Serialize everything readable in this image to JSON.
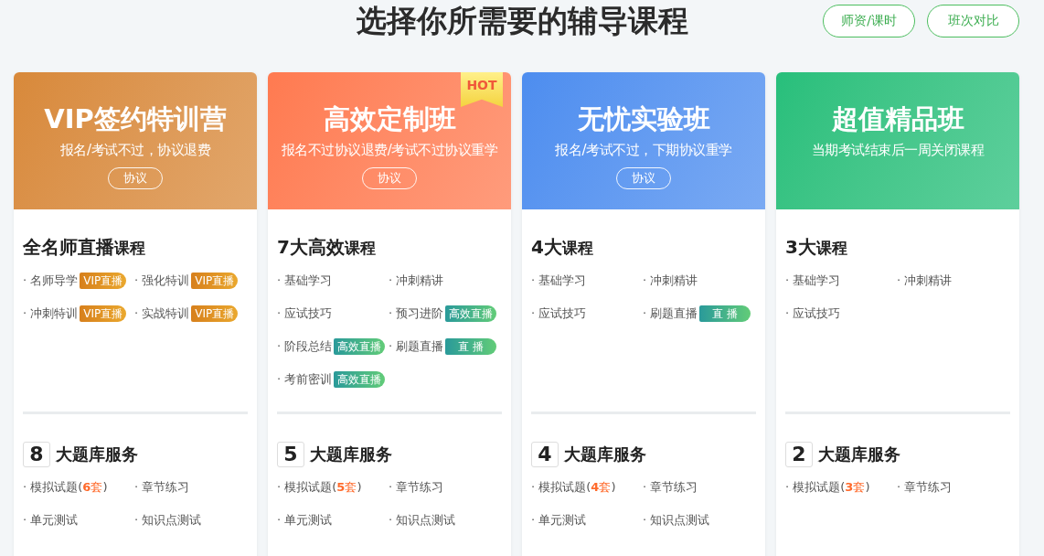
{
  "page_title": "选择你所需要的辅导课程",
  "header_buttons": [
    "师资/课时",
    "班次对比"
  ],
  "cards": [
    {
      "color": "#d8893a",
      "title": "VIP签约特训营",
      "subtitle": "报名/考试不过，协议退费",
      "agreement_button": "协议",
      "courses_heading": {
        "main": "全名师直播",
        "suffix": "课程"
      },
      "courses": [
        {
          "text": "· 名师导学",
          "tag": {
            "kind": "vip",
            "text": "VIP直播"
          }
        },
        {
          "text": "· 强化特训",
          "tag": {
            "kind": "vip",
            "text": "VIP直播"
          }
        },
        {
          "text": "· 冲刺特训",
          "tag": {
            "kind": "vip",
            "text": "VIP直播"
          }
        },
        {
          "text": "· 实战特训",
          "tag": {
            "kind": "vip",
            "text": "VIP直播"
          }
        }
      ],
      "services_count": "8",
      "services_heading": "大题库服务",
      "services": [
        {
          "parts": [
            {
              "text": "· 模拟试题(",
              "accent": false
            },
            {
              "text": "**6**套",
              "accent": true
            },
            {
              "text": ")",
              "accent": false
            }
          ]
        },
        {
          "parts": [
            {
              "text": "· 章节练习",
              "accent": false
            }
          ]
        },
        {
          "parts": [
            {
              "text": "· 单元测试",
              "accent": false
            }
          ]
        },
        {
          "parts": [
            {
              "text": "· 知识点测试",
              "accent": false
            }
          ]
        }
      ]
    },
    {
      "color": "#ff7a50",
      "title": "高效定制班",
      "subtitle": "报名不过协议退费/考试不过协议重学",
      "agreement_button": "协议",
      "hot_badge": "HOT",
      "courses_heading": {
        "main": "7大高效",
        "suffix": "课程"
      },
      "courses": [
        {
          "text": "· 基础学习"
        },
        {
          "text": "· 冲刺精讲"
        },
        {
          "text": "· 应试技巧"
        },
        {
          "text": "· 预习进阶",
          "tag": {
            "kind": "efficient",
            "text": "高效直播"
          }
        },
        {
          "text": "· 阶段总结",
          "tag": {
            "kind": "efficient",
            "text": "高效直播"
          }
        },
        {
          "text": "· 刷题直播",
          "tag": {
            "kind": "live",
            "text": "直 播"
          }
        },
        {
          "text": "· 考前密训",
          "tag": {
            "kind": "efficient",
            "text": "高效直播"
          }
        }
      ],
      "services_count": "5",
      "services_heading": "大题库服务",
      "services": [
        {
          "parts": [
            {
              "text": "· 模拟试题(",
              "accent": false
            },
            {
              "text": "**5**套",
              "accent": true
            },
            {
              "text": ")",
              "accent": false
            }
          ]
        },
        {
          "parts": [
            {
              "text": "· 章节练习",
              "accent": false
            }
          ]
        },
        {
          "parts": [
            {
              "text": "· 单元测试",
              "accent": false
            }
          ]
        },
        {
          "parts": [
            {
              "text": "· 知识点测试",
              "accent": false
            }
          ]
        }
      ]
    },
    {
      "color": "#4d8def",
      "title": "无忧实验班",
      "subtitle": "报名/考试不过，下期协议重学",
      "agreement_button": "协议",
      "courses_heading": {
        "main": "4大",
        "suffix": "课程"
      },
      "courses": [
        {
          "text": "· 基础学习"
        },
        {
          "text": "· 冲刺精讲"
        },
        {
          "text": "· 应试技巧"
        },
        {
          "text": "· 刷题直播",
          "tag": {
            "kind": "live",
            "text": "直 播"
          }
        }
      ],
      "services_count": "4",
      "services_heading": "大题库服务",
      "services": [
        {
          "parts": [
            {
              "text": "· 模拟试题(",
              "accent": false
            },
            {
              "text": "**4**套",
              "accent": true
            },
            {
              "text": ")",
              "accent": false
            }
          ]
        },
        {
          "parts": [
            {
              "text": "· 章节练习",
              "accent": false
            }
          ]
        },
        {
          "parts": [
            {
              "text": "· 单元测试",
              "accent": false
            }
          ]
        },
        {
          "parts": [
            {
              "text": "· 知识点测试",
              "accent": false
            }
          ]
        }
      ]
    },
    {
      "color": "#27bf7b",
      "title": "超值精品班",
      "subtitle": "当期考试结束后一周关闭课程",
      "courses_heading": {
        "main": "3大",
        "suffix": "课程"
      },
      "courses": [
        {
          "text": "· 基础学习"
        },
        {
          "text": "· 冲刺精讲"
        },
        {
          "text": "· 应试技巧"
        }
      ],
      "services_count": "2",
      "services_heading": "大题库服务",
      "services": [
        {
          "parts": [
            {
              "text": "· 模拟试题(",
              "accent": false
            },
            {
              "text": "**3**套",
              "accent": true
            },
            {
              "text": ")",
              "accent": false
            }
          ]
        },
        {
          "parts": [
            {
              "text": "· 章节练习",
              "accent": false
            }
          ]
        }
      ]
    }
  ]
}
